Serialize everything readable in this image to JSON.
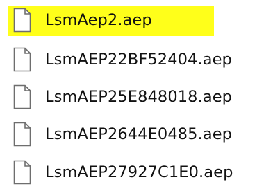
{
  "file_list": {
    "highlight_color": "#ffff1a",
    "icon": "blank-document-icon",
    "files": [
      {
        "name": "LsmAep2.aep",
        "highlighted": true
      },
      {
        "name": "LsmAEP22BF52404.aep",
        "highlighted": false
      },
      {
        "name": "LsmAEP25E848018.aep",
        "highlighted": false
      },
      {
        "name": "LsmAEP2644E0485.aep",
        "highlighted": false
      },
      {
        "name": "LsmAEP27927C1E0.aep",
        "highlighted": false
      }
    ]
  }
}
